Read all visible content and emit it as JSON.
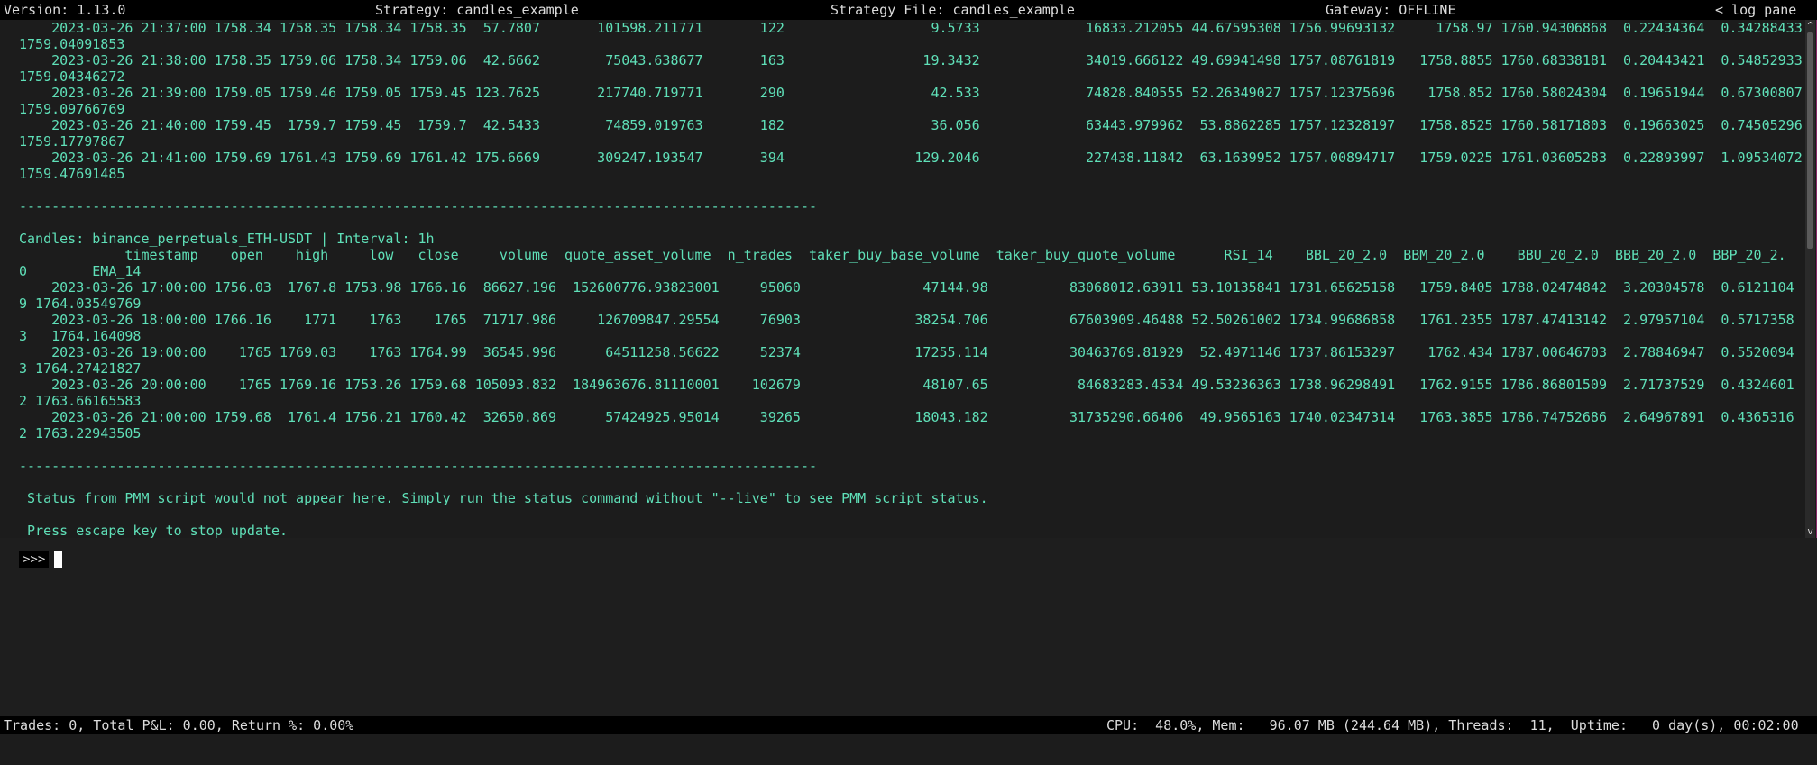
{
  "topbar": {
    "version": "Version: 1.13.0",
    "strategy": "Strategy: candles_example",
    "strategy_file": "Strategy File: candles_example",
    "gateway": "Gateway: OFFLINE",
    "log_pane": "< log pane"
  },
  "output_lines": [
    "    2023-03-26 21:37:00 1758.34 1758.35 1758.34 1758.35  57.7807       101598.211771       122                  9.5733             16833.212055 44.67595308 1756.99693132     1758.97 1760.94306868  0.22434364  0.34288433",
    "1759.04091853",
    "    2023-03-26 21:38:00 1758.35 1759.06 1758.34 1759.06  42.6662        75043.638677       163                 19.3432             34019.666122 49.69941498 1757.08761819   1758.8855 1760.68338181  0.20443421  0.54852933",
    "1759.04346272",
    "    2023-03-26 21:39:00 1759.05 1759.46 1759.05 1759.45 123.7625       217740.719771       290                  42.533             74828.840555 52.26349027 1757.12375696    1758.852 1760.58024304  0.19651944  0.67300807",
    "1759.09766769",
    "    2023-03-26 21:40:00 1759.45  1759.7 1759.45  1759.7  42.5433        74859.019763       182                  36.056             63443.979962  53.8862285 1757.12328197   1758.8525 1760.58171803  0.19663025  0.74505296",
    "1759.17797867",
    "    2023-03-26 21:41:00 1759.69 1761.43 1759.69 1761.42 175.6669       309247.193547       394                129.2046             227438.11842  63.1639952 1757.00894717   1759.0225 1761.03605283  0.22893997  1.09534072",
    "1759.47691485",
    "",
    "--------------------------------------------------------------------------------------------------",
    "",
    "Candles: binance_perpetuals_ETH-USDT | Interval: 1h",
    "             timestamp    open    high     low   close     volume  quote_asset_volume  n_trades  taker_buy_base_volume  taker_buy_quote_volume      RSI_14    BBL_20_2.0  BBM_20_2.0    BBU_20_2.0  BBB_20_2.0  BBP_20_2.",
    "0        EMA_14",
    "    2023-03-26 17:00:00 1756.03  1767.8 1753.98 1766.16  86627.196  152600776.93823001     95060               47144.98          83068012.63911 53.10135841 1731.65625158   1759.8405 1788.02474842  3.20304578  0.6121104",
    "9 1764.03549769",
    "    2023-03-26 18:00:00 1766.16    1771    1763    1765  71717.986     126709847.29554     76903              38254.706          67603909.46488 52.50261002 1734.99686858   1761.2355 1787.47413142  2.97957104  0.5717358",
    "3   1764.164098",
    "    2023-03-26 19:00:00    1765 1769.03    1763 1764.99  36545.996      64511258.56622     52374              17255.114          30463769.81929  52.4971146 1737.86153297    1762.434 1787.00646703  2.78846947  0.5520094",
    "3 1764.27421827",
    "    2023-03-26 20:00:00    1765 1769.16 1753.26 1759.68 105093.832  184963676.81110001    102679               48107.65           84683283.4534 49.53236363 1738.96298491   1762.9155 1786.86801509  2.71737529  0.4324601",
    "2 1763.66165583",
    "    2023-03-26 21:00:00 1759.68  1761.4 1756.21 1760.42  32650.869      57424925.95014     39265              18043.182          31735290.66406  49.9565163 1740.02347314   1763.3855 1786.74752686  2.64967891  0.4365316",
    "2 1763.22943505",
    "",
    "--------------------------------------------------------------------------------------------------",
    "",
    " Status from PMM script would not appear here. Simply run the status command without \"--live\" to see PMM script status.",
    "",
    " Press escape key to stop update."
  ],
  "scrollbar": {
    "up_glyph": "^",
    "down_glyph": "v"
  },
  "input": {
    "prompt": ">>>"
  },
  "statusbar": {
    "left": "Trades: 0, Total P&L: 0.00, Return %: 0.00%",
    "right": "CPU:  48.0%, Mem:   96.07 MB (244.64 MB), Threads:  11,  Uptime:   0 day(s), 00:02:00"
  }
}
